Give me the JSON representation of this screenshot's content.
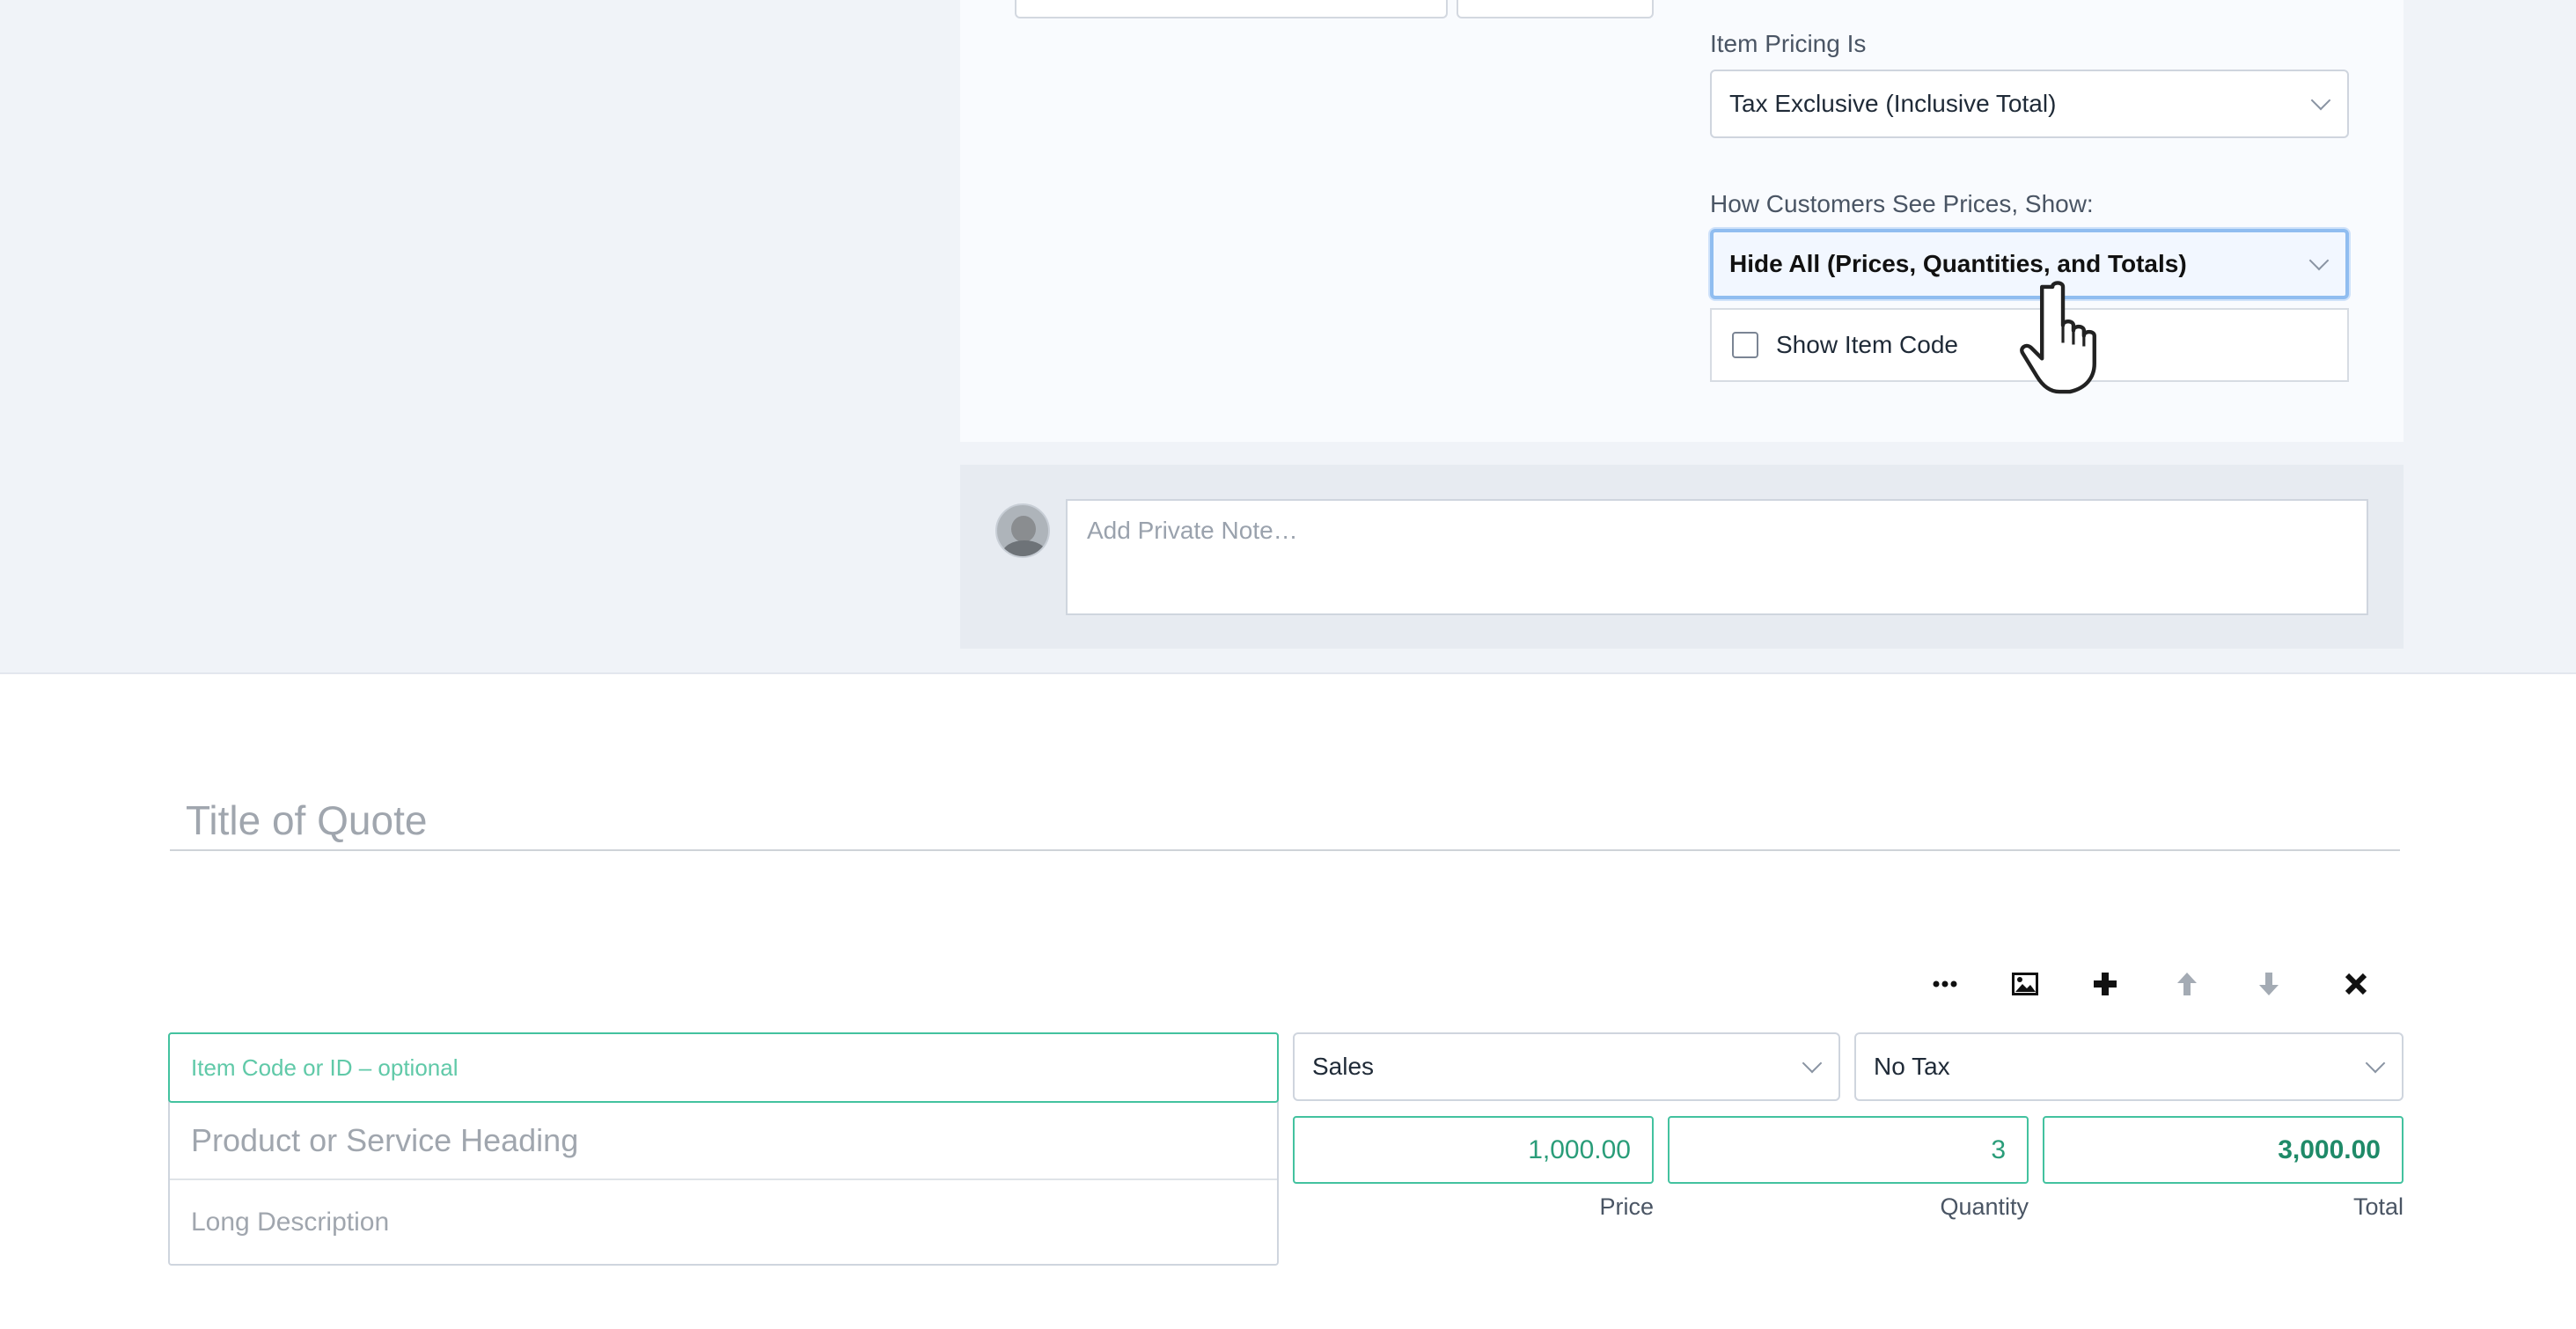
{
  "settings": {
    "item_pricing_label": "Item Pricing Is",
    "item_pricing_value": "Tax Exclusive (Inclusive Total)",
    "customer_view_label": "How Customers See Prices, Show:",
    "customer_view_value": "Hide All (Prices, Quantities, and Totals)",
    "show_item_code_label": "Show Item Code",
    "show_item_code_checked": false
  },
  "note": {
    "placeholder": "Add Private Note…"
  },
  "quote": {
    "title_placeholder": "Title of Quote"
  },
  "item_toolbar": {
    "icons": [
      "more-icon",
      "image-icon",
      "plus-icon",
      "arrow-up-icon",
      "arrow-down-icon",
      "close-icon"
    ]
  },
  "line_item": {
    "code_placeholder": "Item Code or ID – optional",
    "heading_placeholder": "Product or Service Heading",
    "description_placeholder": "Long Description",
    "account": "Sales",
    "tax": "No Tax",
    "price": "1,000.00",
    "quantity": "3",
    "total": "3,000.00",
    "price_label": "Price",
    "quantity_label": "Quantity",
    "total_label": "Total"
  },
  "colors": {
    "accent_green": "#43c29f",
    "focus_blue": "#90bdf0",
    "page_bg": "#f0f3f8"
  }
}
